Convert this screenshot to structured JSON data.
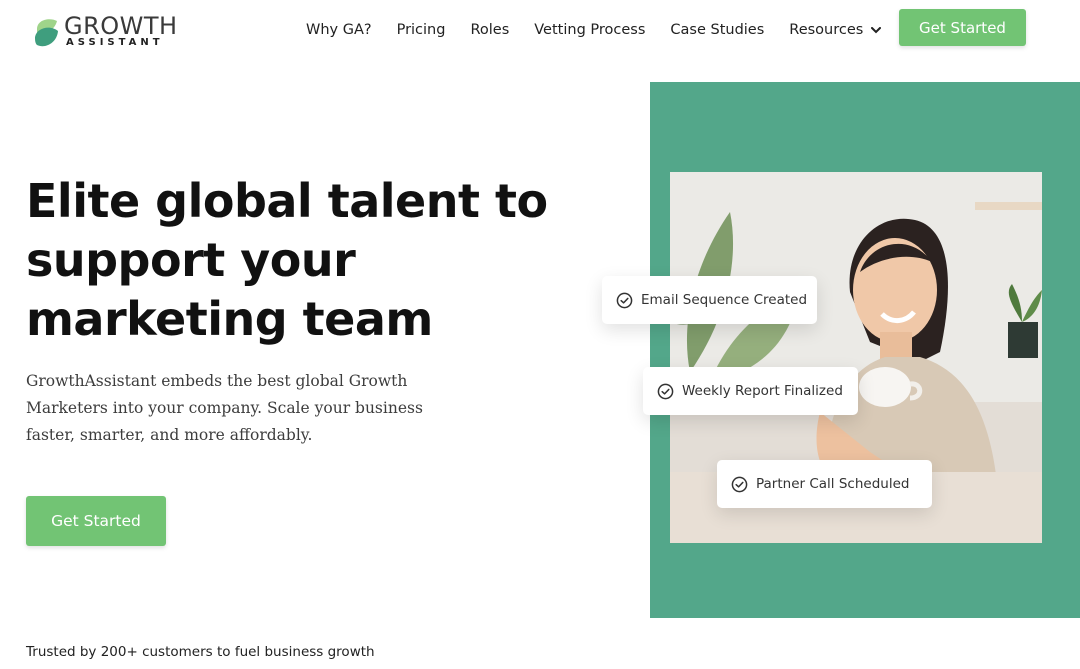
{
  "brand": {
    "name": "GROWTH",
    "tagline": "ASSISTANT",
    "logo_icon": "leaf-logo-icon",
    "colors": {
      "primary_green": "#72c474",
      "panel_green": "#53a78a",
      "logo_green_light": "#8fcf82",
      "logo_green_dark": "#3a9a7a"
    }
  },
  "nav": {
    "items": [
      {
        "label": "Why GA?"
      },
      {
        "label": "Pricing"
      },
      {
        "label": "Roles"
      },
      {
        "label": "Vetting Process"
      },
      {
        "label": "Case Studies"
      },
      {
        "label": "Resources",
        "icon": "chevron-down-icon"
      }
    ],
    "cta_label": "Get Started"
  },
  "hero": {
    "title": "Elite global talent to support your marketing team",
    "subtitle": "GrowthAssistant embeds the best global Growth Marketers into your company. Scale your business faster, smarter, and more affordably.",
    "cta_label": "Get Started"
  },
  "cards": [
    {
      "label": "Email Sequence Created",
      "icon": "check-circle-icon"
    },
    {
      "label": "Weekly Report Finalized",
      "icon": "check-circle-icon"
    },
    {
      "label": "Partner Call Scheduled",
      "icon": "check-circle-icon"
    }
  ],
  "trusted": {
    "text": "Trusted by 200+ customers to fuel business growth"
  }
}
